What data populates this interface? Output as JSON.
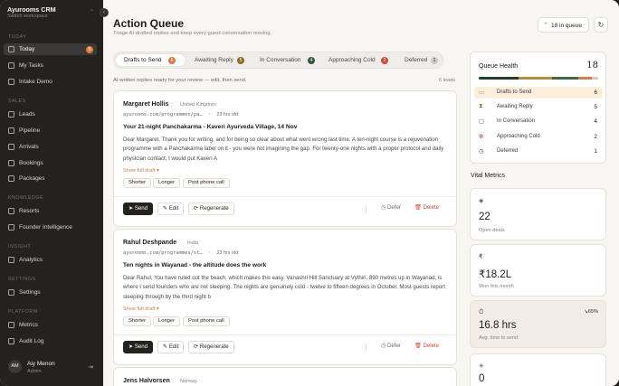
{
  "brand": {
    "name": "Ayurooms CRM",
    "sub": "Switch workspace"
  },
  "sidebar": {
    "sections": [
      {
        "label": "TODAY",
        "items": [
          {
            "label": "Today",
            "badge": "6",
            "active": true
          },
          {
            "label": "My Tasks"
          },
          {
            "label": "Intake Demo"
          }
        ]
      },
      {
        "label": "SALES",
        "items": [
          {
            "label": "Leads"
          },
          {
            "label": "Pipeline"
          },
          {
            "label": "Arrivals"
          },
          {
            "label": "Bookings"
          },
          {
            "label": "Packages"
          }
        ]
      },
      {
        "label": "KNOWLEDGE",
        "items": [
          {
            "label": "Resorts"
          },
          {
            "label": "Founder Intelligence"
          }
        ]
      },
      {
        "label": "INSIGHT",
        "items": [
          {
            "label": "Analytics"
          }
        ]
      },
      {
        "label": "SETTINGS",
        "items": [
          {
            "label": "Settings"
          }
        ]
      },
      {
        "label": "PLATFORM",
        "items": [
          {
            "label": "Metrics"
          },
          {
            "label": "Audit Log"
          }
        ]
      }
    ],
    "user": {
      "initials": "AM",
      "name": "Aiy Menon",
      "role": "Admin"
    }
  },
  "header": {
    "title": "Action Queue",
    "subtitle": "Triage AI-drafted replies and keep every guest conversation moving.",
    "queue_label": "18 in queue"
  },
  "tabs": [
    {
      "label": "Drafts to Send",
      "count": "6",
      "color": "#e07a3f",
      "active": true
    },
    {
      "label": "Awaiting Reply",
      "count": "5",
      "color": "#8a6d1f"
    },
    {
      "label": "In Conversation",
      "count": "4",
      "color": "#2e5a3c"
    },
    {
      "label": "Approaching Cold",
      "count": "2",
      "color": "#d14a3a"
    },
    {
      "label": "Deferred",
      "count": "1",
      "color": "#cfcac2"
    }
  ],
  "list": {
    "hint": "AI-written replies ready for your review — edit, then send.",
    "count_label": "6 leads"
  },
  "cards": [
    {
      "name": "Margaret Hollis",
      "country": "United Kingdom",
      "email": "ayurooms.com/programmes/pa…",
      "age": "23 hrs old",
      "subject": "Your 21-night Panchakarma - Kaveri Ayurveda Village, 14 Nov",
      "body": "Dear Margaret, Thank you for writing, and for being so clear about what went wrong last time. A ten-night course is a rejuvenation programme with a Panchakarma label on it - you were not imagining the gap. For twenty-one nights with a proper protocol and daily physician contact, I would put Kaveri A",
      "show_full": "Show full draft ▾",
      "chips": [
        "Shorter",
        "Longer",
        "Post phone call"
      ],
      "actions": {
        "send": "Send",
        "edit": "Edit",
        "regenerate": "Regenerate",
        "defer": "Defer",
        "delete": "Delete"
      }
    },
    {
      "name": "Rahul Deshpande",
      "country": "India",
      "email": "ayurooms.com/programmes/st…",
      "age": "23 hrs old",
      "subject": "Ten nights in Wayanad - the altitude does the work",
      "body": "Dear Rahul, You have ruled out the beach, which makes this easy. Vanashri Hill Sanctuary at Vythiri, 890 metres up in Wayanad, is where I send founders who are not sleeping. The nights are genuinely cold - twelve to fifteen degrees in October. Most guests report sleeping through by the third night b",
      "show_full": "Show full draft ▾",
      "chips": [
        "Shorter",
        "Longer",
        "Post phone call"
      ],
      "actions": {
        "send": "Send",
        "edit": "Edit",
        "regenerate": "Regenerate",
        "defer": "Defer",
        "delete": "Delete"
      }
    },
    {
      "name": "Jens Halvorsen",
      "country": "Norway"
    }
  ],
  "queue_health": {
    "title": "Queue Health",
    "total": "18",
    "rows": [
      {
        "icon": "inbox-icon",
        "label": "Drafts to Send",
        "value": "6",
        "color": "#e07a3f",
        "active": true
      },
      {
        "icon": "hourglass-icon",
        "label": "Awaiting Reply",
        "value": "5",
        "color": "#8a6d1f"
      },
      {
        "icon": "chat-icon",
        "label": "In Conversation",
        "value": "4",
        "color": "#2e5a3c"
      },
      {
        "icon": "snowflake-icon",
        "label": "Approaching Cold",
        "value": "2",
        "color": "#d14a3a"
      },
      {
        "icon": "clock-icon",
        "label": "Deferred",
        "value": "1",
        "color": "#3a3935"
      }
    ],
    "bar_colors": [
      "#1f3d2b",
      "#b98a3a",
      "#3d6a4b",
      "#e07a3f",
      "#cfcac2"
    ]
  },
  "vital_metrics": {
    "title": "Vital Metrics",
    "cards": [
      {
        "icon": "layers-icon",
        "value": "22",
        "label": "Open deals"
      },
      {
        "icon": "rupee-icon",
        "value": "₹18.2L",
        "label": "Won this month"
      },
      {
        "icon": "timer-icon",
        "value": "16.8 hrs",
        "label": "Avg. time to send",
        "trend": "↘65%"
      },
      {
        "icon": "sparkle-icon",
        "value": "0",
        "label": ""
      }
    ]
  }
}
